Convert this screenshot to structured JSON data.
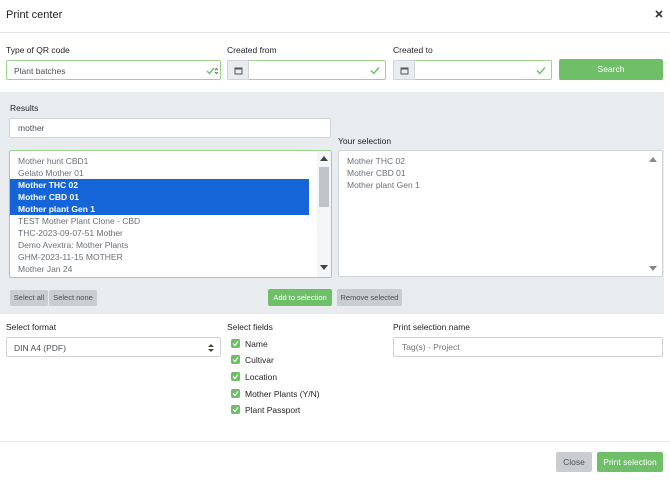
{
  "modal": {
    "title": "Print center"
  },
  "filters": {
    "qr_type_label": "Type of QR code",
    "qr_type_value": "Plant batches",
    "created_from_label": "Created from",
    "created_to_label": "Created to",
    "search_label": "Search"
  },
  "results": {
    "label": "Results",
    "search_value": "mother",
    "items": [
      "Mother hunt CBD1",
      "Gelato Mother 01",
      "Mother THC 02",
      "Mother CBD 01",
      "Mother plant Gen 1",
      "TEST Mother Plant Clone - CBD",
      "THC-2023-09-07-51 Mother",
      "Demo Avextra: Mother Plants",
      "GHM-2023-11-15 MOTHER",
      "Mother Jan 24"
    ],
    "select_all_label": "Select all",
    "select_none_label": "Select none",
    "add_label": "Add to selection"
  },
  "selection": {
    "label": "Your selection",
    "items": [
      "Mother THC 02",
      "Mother CBD 01",
      "Mother plant Gen 1"
    ],
    "remove_label": "Remove selected"
  },
  "format": {
    "label": "Select format",
    "value": "DIN A4 (PDF)"
  },
  "fields": {
    "label": "Select fields",
    "items": [
      "Name",
      "Cultivar",
      "Location",
      "Mother Plants (Y/N)",
      "Plant Passport"
    ]
  },
  "print_name": {
    "label": "Print selection name",
    "placeholder": "Tag(s) - Project"
  },
  "footer": {
    "close_label": "Close",
    "print_label": "Print selection"
  },
  "colors": {
    "accent": "#6fbf68",
    "selected": "#1565d8",
    "panel": "#e9ecef"
  }
}
